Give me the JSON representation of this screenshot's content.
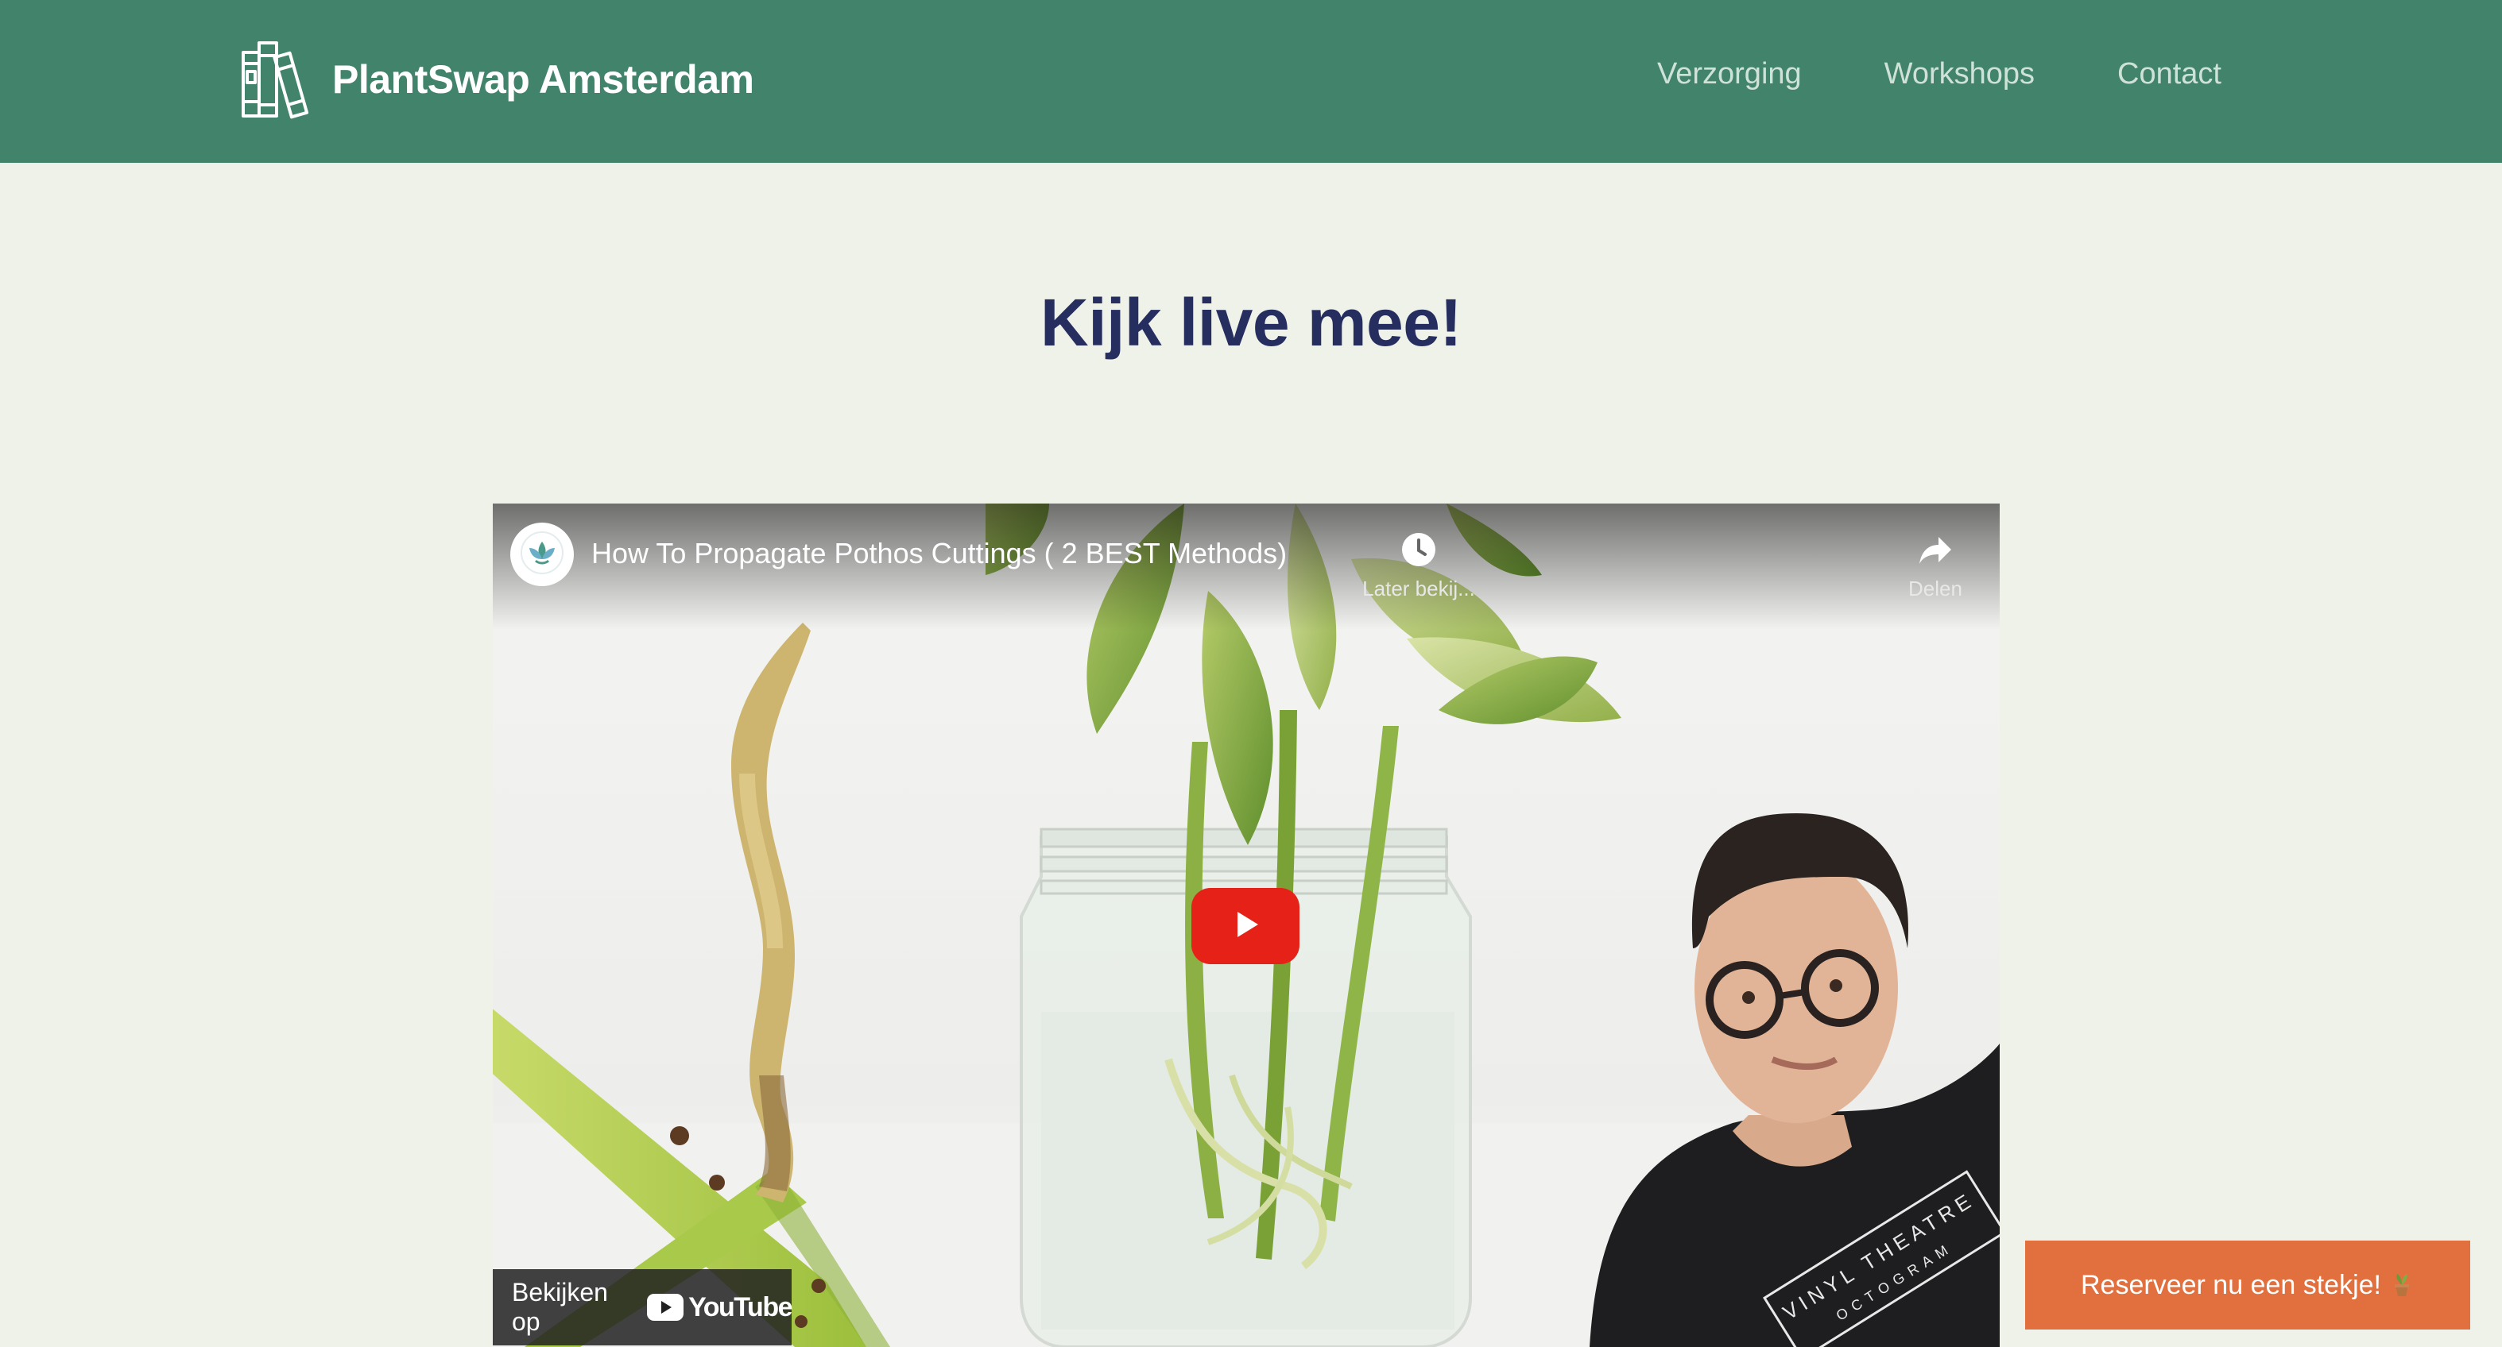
{
  "brand": {
    "name": "PlantSwap Amsterdam",
    "logo_icon": "books-icon",
    "header_color": "#41836b"
  },
  "nav": {
    "items": [
      {
        "label": "Verzorging"
      },
      {
        "label": "Workshops"
      },
      {
        "label": "Contact"
      }
    ]
  },
  "main": {
    "title": "Kijk live mee!",
    "title_color": "#262d5f"
  },
  "video": {
    "title": "How To Propagate Pothos Cuttings ( 2 BEST Methods)",
    "channel_icon": "plant-leaf-icon",
    "watch_later_label": "Later bekij...",
    "share_label": "Delen",
    "watch_on_label": "Bekijken op",
    "platform": "YouTube",
    "play_color": "#e62117"
  },
  "cta": {
    "label": "Reserveer nu een stekje!",
    "icon": "potted-plant-icon",
    "color": "#e2703e"
  }
}
